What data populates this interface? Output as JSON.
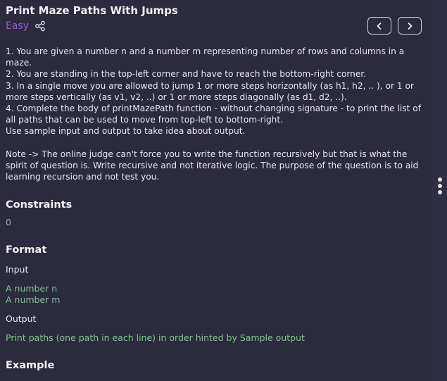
{
  "problem": {
    "title": "Print Maze Paths With Jumps",
    "difficulty": "Easy",
    "statement": [
      "1. You are given a number n and a number m representing number of rows and columns in a maze.",
      "2. You are standing in the top-left corner and have to reach the bottom-right corner.",
      "3. In a single move you are allowed to jump 1 or more steps horizontally (as h1, h2, .. ), or 1 or more steps vertically (as v1, v2, ..) or 1 or more steps diagonally (as d1, d2, ..).",
      "4. Complete the body of printMazePath function - without changing signature - to print the list of all paths that can be used to move from top-left to bottom-right.",
      "Use sample input and output to take idea about output."
    ],
    "note": "Note -> The online judge can't force you to write the function recursively but that is what the spirit of question is. Write recursive and not iterative logic. The purpose of the question is to aid learning recursion and not test you."
  },
  "constraints": {
    "heading": "Constraints",
    "value": "0"
  },
  "format": {
    "heading": "Format",
    "input_label": "Input",
    "input_lines": [
      "A number n",
      "A number m"
    ],
    "output_label": "Output",
    "output_text": "Print paths (one path in each line) in order hinted by Sample output"
  },
  "example": {
    "heading": "Example"
  },
  "icons": {
    "share": "share-icon",
    "prev": "chevron-left-icon",
    "next": "chevron-right-icon",
    "menu": "more-vertical-icon"
  },
  "colors": {
    "background": "#2b2a3e",
    "difficulty": "#9b59d6",
    "green_text": "#7fc88a"
  }
}
